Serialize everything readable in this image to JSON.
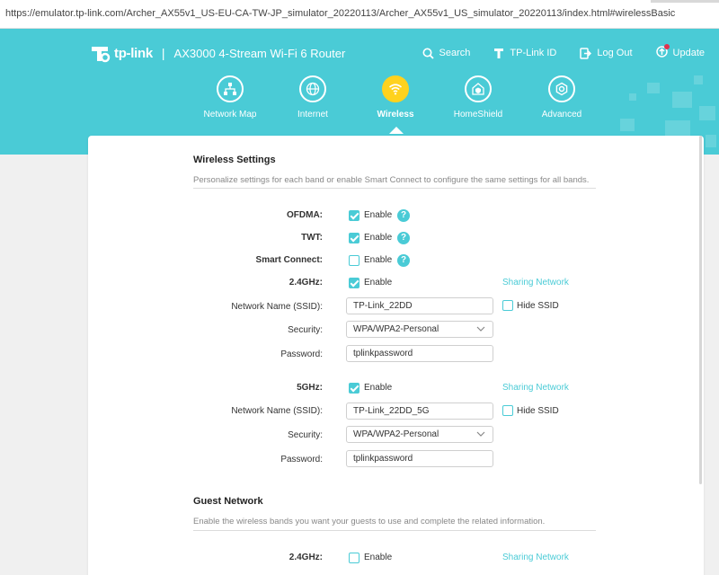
{
  "browser": {
    "url": "https://emulator.tp-link.com/Archer_AX55v1_US-EU-CA-TW-JP_simulator_20220113/Archer_AX55v1_US_simulator_20220113/index.html#wirelessBasic"
  },
  "header": {
    "brand": "tp-link",
    "separator": "|",
    "model": "AX3000 4-Stream Wi-Fi 6 Router",
    "actions": {
      "search": "Search",
      "tplink_id": "TP-Link ID",
      "logout": "Log Out",
      "update": "Update"
    }
  },
  "nav": {
    "network_map": "Network Map",
    "internet": "Internet",
    "wireless": "Wireless",
    "homeshield": "HomeShield",
    "advanced": "Advanced"
  },
  "wireless_settings": {
    "title": "Wireless Settings",
    "description": "Personalize settings for each band or enable Smart Connect to configure the same settings for all bands.",
    "ofdma": {
      "label": "OFDMA:",
      "option": "Enable",
      "checked": true,
      "help": "?"
    },
    "twt": {
      "label": "TWT:",
      "option": "Enable",
      "checked": true,
      "help": "?"
    },
    "smart_connect": {
      "label": "Smart Connect:",
      "option": "Enable",
      "checked": false,
      "help": "?"
    },
    "band_24": {
      "label": "2.4GHz:",
      "option": "Enable",
      "checked": true,
      "sharing_link": "Sharing Network",
      "ssid_label": "Network Name (SSID):",
      "ssid": "TP-Link_22DD",
      "hide_ssid": "Hide SSID",
      "hide_checked": false,
      "security_label": "Security:",
      "security": "WPA/WPA2-Personal",
      "password_label": "Password:",
      "password": "tplinkpassword"
    },
    "band_5": {
      "label": "5GHz:",
      "option": "Enable",
      "checked": true,
      "sharing_link": "Sharing Network",
      "ssid_label": "Network Name (SSID):",
      "ssid": "TP-Link_22DD_5G",
      "hide_ssid": "Hide SSID",
      "hide_checked": false,
      "security_label": "Security:",
      "security": "WPA/WPA2-Personal",
      "password_label": "Password:",
      "password": "tplinkpassword"
    }
  },
  "guest_network": {
    "title": "Guest Network",
    "description": "Enable the wireless bands you want your guests to use and complete the related information.",
    "band_24": {
      "label": "2.4GHz:",
      "option": "Enable",
      "checked": false,
      "sharing_link": "Sharing Network"
    }
  },
  "colors": {
    "accent": "#4acbd6",
    "active_nav": "#ffd21e"
  }
}
